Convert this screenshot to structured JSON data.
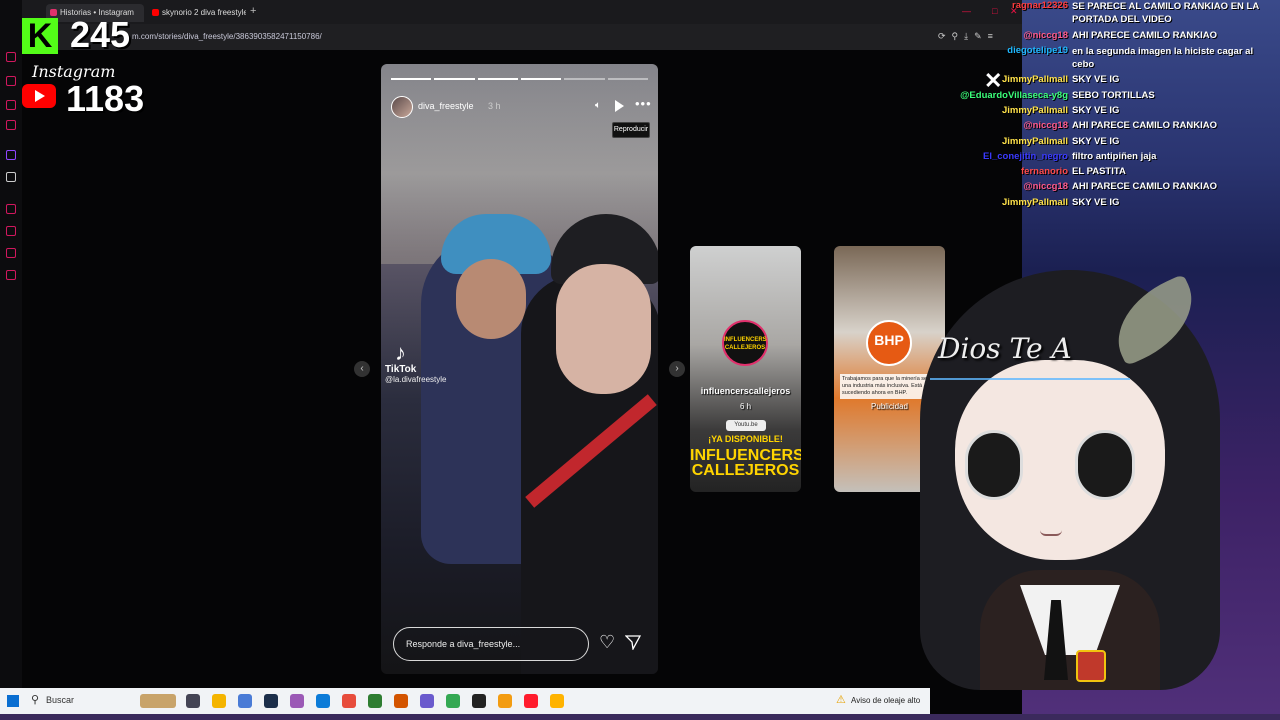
{
  "browser": {
    "tabs": [
      {
        "label": "Historias • Instagram",
        "active": true
      },
      {
        "label": "skynorio 2 diva freestyle",
        "active": false
      }
    ],
    "url": "m.com/stories/diva_freestyle/3863903582471150786/"
  },
  "overlay": {
    "kick_count": "245",
    "instagram_label": "Instagram",
    "youtube_count": "1183"
  },
  "story": {
    "username": "diva_freestyle",
    "time": "3 h",
    "tooltip": "Reproducir",
    "tiktok_name": "TikTok",
    "tiktok_handle": "@la.divafreestyle",
    "reply_placeholder": "Responde a diva_freestyle...",
    "progress_segments": 6,
    "progress_done": 4
  },
  "previews": [
    {
      "username": "influencerscallejeros",
      "time": "6 h",
      "avatar_text": "INFLUENCERS CALLEJEROS",
      "badge": "Youtu.be",
      "line1": "¡YA DISPONIBLE!",
      "line2": "INFLUENCERS CALLEJEROS"
    },
    {
      "brand": "BHP",
      "text": "Trabajamos para que la minería sea una industria más inclusiva. Está sucediendo ahora en BHP.",
      "sponsored": "Publicidad"
    }
  ],
  "chat": [
    {
      "user": "ragnar12326",
      "msg": "SE PARECE AL CAMILO RANKIAO EN LA PORTADA DEL VIDEO",
      "color": "#ff3b3b"
    },
    {
      "user": "@niccg18",
      "msg": "AHI PARECE CAMILO RANKIAO",
      "color": "#ff5a8a"
    },
    {
      "user": "diegotelipe19",
      "msg": "en la segunda imagen la hiciste cagar al cebo",
      "color": "#1fb8ff"
    },
    {
      "user": "JimmyPallmall",
      "msg": "SKY VE IG",
      "color": "#ffe24a"
    },
    {
      "user": "@EduardoVillaseca-y8g",
      "msg": "SEBO TORTILLAS",
      "color": "#3bff7a"
    },
    {
      "user": "JimmyPallmall",
      "msg": "SKY VE IG",
      "color": "#ffe24a"
    },
    {
      "user": "@niccg18",
      "msg": "AHI PARECE CAMILO RANKIAO",
      "color": "#ff5a8a"
    },
    {
      "user": "JimmyPallmall",
      "msg": "SKY VE IG",
      "color": "#ffe24a"
    },
    {
      "user": "El_conejitin_negro",
      "msg": "filtro antipiñen jaja",
      "color": "#3a3aff"
    },
    {
      "user": "fernanorio",
      "msg": "EL PASTITA",
      "color": "#ff4a4a"
    },
    {
      "user": "@niccg18",
      "msg": "AHI PARECE CAMILO RANKIAO",
      "color": "#ff5a8a"
    },
    {
      "user": "JimmyPallmall",
      "msg": "SKY VE IG",
      "color": "#ffe24a"
    }
  ],
  "avatar_overlay": {
    "caption": "Dios Te A"
  },
  "taskbar": {
    "search": "Buscar",
    "weather": "Aviso de oleaje alto"
  },
  "colors": {
    "kick": "#53fc18",
    "youtube": "#ff0000",
    "instagram": "#e1306c"
  }
}
